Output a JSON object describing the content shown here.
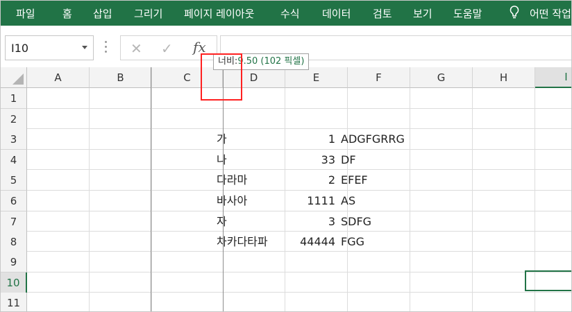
{
  "ribbon": {
    "tabs": [
      "파일",
      "홈",
      "삽입",
      "그리기",
      "페이지 레이아웃",
      "수식",
      "데이터",
      "검토",
      "보기",
      "도움말"
    ],
    "tell_me": "어떤 작업",
    "accent_color": "#217346"
  },
  "formula_bar": {
    "name_box": "I10",
    "cancel_icon": "✕",
    "enter_icon": "✓",
    "fx_label": "fx",
    "value": ""
  },
  "tooltip": {
    "label": "너비:",
    "value": "9.50 (102 픽셀)"
  },
  "grid": {
    "columns": [
      "A",
      "B",
      "C",
      "D",
      "E",
      "F",
      "G",
      "H",
      "I"
    ],
    "selected_column": "I",
    "rows": [
      "1",
      "2",
      "3",
      "4",
      "5",
      "6",
      "7",
      "8",
      "9",
      "10",
      "11"
    ],
    "selected_row": "10",
    "data": [
      {
        "row": "3",
        "d": "가",
        "e": "1",
        "f": "ADGFGRRG"
      },
      {
        "row": "4",
        "d": "나",
        "e": "33",
        "f": "DF"
      },
      {
        "row": "5",
        "d": "다라마",
        "e": "2",
        "f": "EFEF"
      },
      {
        "row": "6",
        "d": "바사아",
        "e": "1111",
        "f": "AS"
      },
      {
        "row": "7",
        "d": "자",
        "e": "3",
        "f": "SDFG"
      },
      {
        "row": "8",
        "d": "차카다타파",
        "e": "44444",
        "f": "FGG"
      }
    ]
  }
}
